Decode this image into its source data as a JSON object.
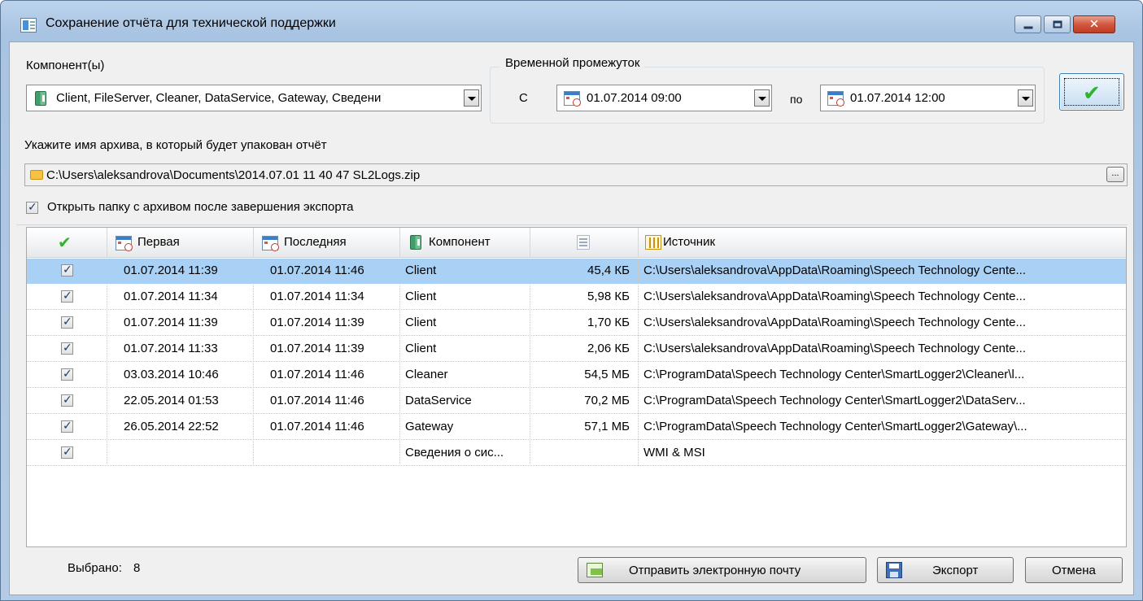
{
  "window": {
    "title": "Сохранение отчёта для технической поддержки",
    "close_glyph": "✕"
  },
  "components": {
    "label": "Компонент(ы)",
    "value": "Client, FileServer, Cleaner, DataService, Gateway, Сведени"
  },
  "period": {
    "label": "Временной промежуток",
    "from_label": "С",
    "from_value": "01.07.2014 09:00",
    "to_label": "по",
    "to_value": "01.07.2014 12:00"
  },
  "archive": {
    "label": "Укажите имя архива, в который будет упакован отчёт",
    "path": "C:\\Users\\aleksandrova\\Documents\\2014.07.01 11 40 47 SL2Logs.zip",
    "browse_label": "...",
    "open_folder_label": "Открыть папку с архивом после завершения экспорта",
    "open_folder_checked": true
  },
  "table": {
    "columns": {
      "check": "✔",
      "first": "Первая",
      "last": "Последняя",
      "component": "Компонент",
      "size": "",
      "source": "Источник"
    },
    "rows": [
      {
        "checked": true,
        "first": "01.07.2014 11:39",
        "last": "01.07.2014 11:46",
        "component": "Client",
        "size": "45,4 КБ",
        "source": "C:\\Users\\aleksandrova\\AppData\\Roaming\\Speech Technology Cente..."
      },
      {
        "checked": true,
        "first": "01.07.2014 11:34",
        "last": "01.07.2014 11:34",
        "component": "Client",
        "size": "5,98 КБ",
        "source": "C:\\Users\\aleksandrova\\AppData\\Roaming\\Speech Technology Cente..."
      },
      {
        "checked": true,
        "first": "01.07.2014 11:39",
        "last": "01.07.2014 11:39",
        "component": "Client",
        "size": "1,70 КБ",
        "source": "C:\\Users\\aleksandrova\\AppData\\Roaming\\Speech Technology Cente..."
      },
      {
        "checked": true,
        "first": "01.07.2014 11:33",
        "last": "01.07.2014 11:39",
        "component": "Client",
        "size": "2,06 КБ",
        "source": "C:\\Users\\aleksandrova\\AppData\\Roaming\\Speech Technology Cente..."
      },
      {
        "checked": true,
        "first": "03.03.2014 10:46",
        "last": "01.07.2014 11:46",
        "component": "Cleaner",
        "size": "54,5 МБ",
        "source": "C:\\ProgramData\\Speech Technology Center\\SmartLogger2\\Cleaner\\l..."
      },
      {
        "checked": true,
        "first": "22.05.2014 01:53",
        "last": "01.07.2014 11:46",
        "component": "DataService",
        "size": "70,2 МБ",
        "source": "C:\\ProgramData\\Speech Technology Center\\SmartLogger2\\DataServ..."
      },
      {
        "checked": true,
        "first": "26.05.2014 22:52",
        "last": "01.07.2014 11:46",
        "component": "Gateway",
        "size": "57,1 МБ",
        "source": "C:\\ProgramData\\Speech Technology Center\\SmartLogger2\\Gateway\\..."
      },
      {
        "checked": true,
        "first": "",
        "last": "",
        "component": "Сведения о сис...",
        "size": "",
        "source": "WMI & MSI"
      }
    ]
  },
  "footer": {
    "selected_label": "Выбрано:",
    "selected_count": "8",
    "email_button": "Отправить электронную почту",
    "export_button": "Экспорт",
    "cancel_button": "Отмена"
  }
}
